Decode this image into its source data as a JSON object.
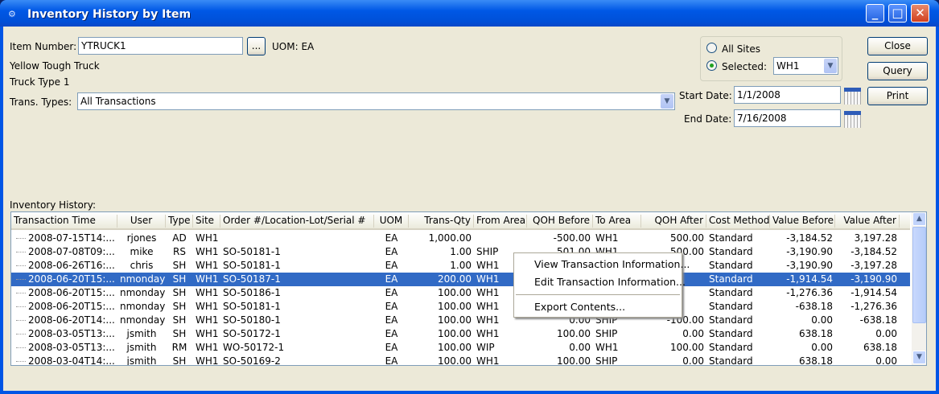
{
  "window": {
    "title": "Inventory History by Item",
    "minimize": "_",
    "maximize": "□",
    "close": "✕"
  },
  "form": {
    "item_number_label": "Item Number:",
    "item_number": "YTRUCK1",
    "lookup": "...",
    "uom": "UOM: EA",
    "description1": "Yellow Tough Truck",
    "description2": "Truck Type 1",
    "trans_types_label": "Trans. Types:",
    "trans_types": "All Transactions",
    "all_sites": "All Sites",
    "selected_label": "Selected:",
    "site": "WH1",
    "start_date_label": "Start Date:",
    "start_date": "1/1/2008",
    "end_date_label": "End Date:",
    "end_date": "7/16/2008"
  },
  "buttons": {
    "close": "Close",
    "query": "Query",
    "print": "Print"
  },
  "history": {
    "label": "Inventory History:",
    "columns": [
      "Transaction Time",
      "User",
      "Type",
      "Site",
      "Order #/Location-Lot/Serial #",
      "UOM",
      "Trans-Qty",
      "From Area",
      "QOH Before",
      "To Area",
      "QOH After",
      "Cost Method",
      "Value Before",
      "Value After"
    ],
    "selected_row": 3,
    "rows": [
      [
        "2008-07-15T14:...",
        "rjones",
        "AD",
        "WH1",
        "",
        "EA",
        "1,000.00",
        "",
        "-500.00",
        "WH1",
        "500.00",
        "Standard",
        "-3,184.52",
        "3,197.28"
      ],
      [
        "2008-07-08T09:...",
        "mike",
        "RS",
        "WH1",
        "SO-50181-1",
        "EA",
        "1.00",
        "SHIP",
        "501.00",
        "WH1",
        "500.00",
        "Standard",
        "-3,190.90",
        "-3,184.52"
      ],
      [
        "2008-06-26T16:...",
        "chris",
        "SH",
        "WH1",
        "SO-50181-1",
        "EA",
        "1.00",
        "WH1",
        "",
        "",
        "",
        "Standard",
        "-3,190.90",
        "-3,197.28"
      ],
      [
        "2008-06-20T15:...",
        "nmonday",
        "SH",
        "WH1",
        "SO-50187-1",
        "EA",
        "200.00",
        "WH1",
        "",
        "",
        "",
        "Standard",
        "-1,914.54",
        "-3,190.90"
      ],
      [
        "2008-06-20T15:...",
        "nmonday",
        "SH",
        "WH1",
        "SO-50186-1",
        "EA",
        "100.00",
        "WH1",
        "",
        "",
        "",
        "Standard",
        "-1,276.36",
        "-1,914.54"
      ],
      [
        "2008-06-20T15:...",
        "nmonday",
        "SH",
        "WH1",
        "SO-50181-1",
        "EA",
        "100.00",
        "WH1",
        "",
        "",
        "",
        "Standard",
        "-638.18",
        "-1,276.36"
      ],
      [
        "2008-06-20T14:...",
        "nmonday",
        "SH",
        "WH1",
        "SO-50180-1",
        "EA",
        "100.00",
        "WH1",
        "0.00",
        "SHIP",
        "-100.00",
        "Standard",
        "0.00",
        "-638.18"
      ],
      [
        "2008-03-05T13:...",
        "jsmith",
        "SH",
        "WH1",
        "SO-50172-1",
        "EA",
        "100.00",
        "WH1",
        "100.00",
        "SHIP",
        "0.00",
        "Standard",
        "638.18",
        "0.00"
      ],
      [
        "2008-03-05T13:...",
        "jsmith",
        "RM",
        "WH1",
        "WO-50172-1",
        "EA",
        "100.00",
        "WIP",
        "0.00",
        "WH1",
        "100.00",
        "Standard",
        "0.00",
        "638.18"
      ],
      [
        "2008-03-04T14:...",
        "jsmith",
        "SH",
        "WH1",
        "SO-50169-2",
        "EA",
        "100.00",
        "WH1",
        "100.00",
        "SHIP",
        "0.00",
        "Standard",
        "638.18",
        "0.00"
      ]
    ]
  },
  "context_menu": {
    "items": [
      "View Transaction Information...",
      "Edit Transaction Information...",
      "Export Contents..."
    ]
  }
}
